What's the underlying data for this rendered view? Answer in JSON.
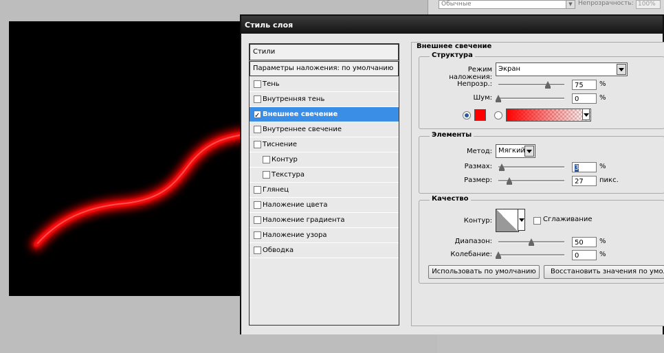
{
  "toolbar_top": {
    "blend_value": "Обычные",
    "opacity_label": "Непрозрачность:",
    "opacity_value": "100%"
  },
  "dialog": {
    "title": "Стиль слоя",
    "styles_header": "Стили",
    "blending_options": "Параметры наложения: по умолчанию",
    "items": [
      {
        "label": "Тень",
        "checked": false
      },
      {
        "label": "Внутренняя тень",
        "checked": false
      },
      {
        "label": "Внешнее свечение",
        "checked": true,
        "selected": true
      },
      {
        "label": "Внутреннее свечение",
        "checked": false
      },
      {
        "label": "Тиснение",
        "checked": false
      },
      {
        "label": "Контур",
        "checked": false,
        "sub": true
      },
      {
        "label": "Текстура",
        "checked": false,
        "sub": true
      },
      {
        "label": "Глянец",
        "checked": false
      },
      {
        "label": "Наложение цвета",
        "checked": false
      },
      {
        "label": "Наложение градиента",
        "checked": false
      },
      {
        "label": "Наложение узора",
        "checked": false
      },
      {
        "label": "Обводка",
        "checked": false
      }
    ]
  },
  "outer_glow": {
    "title": "Внешнее свечение",
    "structure": {
      "title": "Структура",
      "blend_mode_label": "Режим наложения:",
      "blend_mode_value": "Экран",
      "opacity_label": "Непрозр.:",
      "opacity_value": "75",
      "opacity_level": 0.75,
      "noise_label": "Шум:",
      "noise_value": "0",
      "unit": "%",
      "glow_color": "#ff0000"
    },
    "elements": {
      "title": "Элементы",
      "method_label": "Метод:",
      "method_value": "Мягкий",
      "spread_label": "Размах:",
      "spread_value": "3",
      "size_label": "Размер:",
      "size_value": "27",
      "px_unit": "пикс.",
      "unit": "%"
    },
    "quality": {
      "title": "Качество",
      "contour_label": "Контур:",
      "antialias_label": "Сглаживание",
      "range_label": "Диапазон:",
      "range_value": "50",
      "jitter_label": "Колебание:",
      "jitter_value": "0",
      "unit": "%"
    },
    "buttons": {
      "make_default": "Использовать по умолчанию",
      "reset_default": "Восстановить значения по умолчанию"
    }
  }
}
